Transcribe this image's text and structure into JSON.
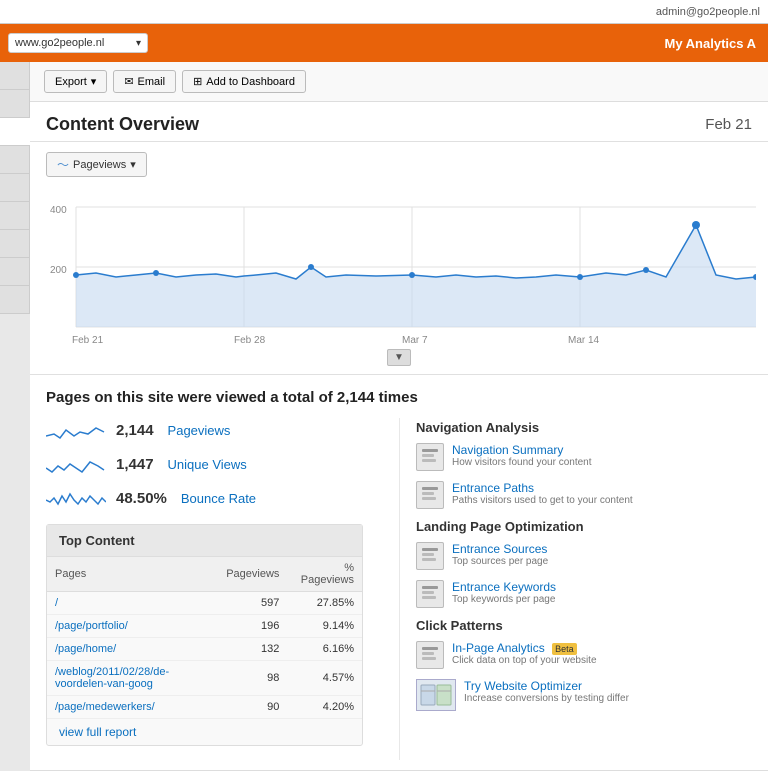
{
  "topbar": {
    "user": "admin@go2people.nl"
  },
  "navbar": {
    "url_input": "www.go2people.nl",
    "title": "My Analytics A"
  },
  "toolbar": {
    "export_label": "Export",
    "email_label": "Email",
    "dashboard_label": "Add to Dashboard"
  },
  "content_header": {
    "title": "Content Overview",
    "date": "Feb 21"
  },
  "chart": {
    "metric_btn": "Pageviews",
    "y_labels": [
      "400",
      "200"
    ],
    "x_labels": [
      "Feb 21",
      "Feb 28",
      "Mar 7",
      "Mar 14"
    ]
  },
  "stats": {
    "headline": "Pages on this site were viewed a total of 2,144 times",
    "items": [
      {
        "value": "2,144",
        "label": "Pageviews"
      },
      {
        "value": "1,447",
        "label": "Unique Views"
      },
      {
        "value": "48.50%",
        "label": "Bounce Rate"
      }
    ]
  },
  "nav_analysis": {
    "title": "Navigation Analysis",
    "items": [
      {
        "title": "Navigation Summary",
        "desc": "How visitors found your content"
      },
      {
        "title": "Entrance Paths",
        "desc": "Paths visitors used to get to your content"
      }
    ]
  },
  "landing_optimization": {
    "title": "Landing Page Optimization",
    "items": [
      {
        "title": "Entrance Sources",
        "desc": "Top sources per page"
      },
      {
        "title": "Entrance Keywords",
        "desc": "Top keywords per page"
      }
    ]
  },
  "click_patterns": {
    "title": "Click Patterns",
    "items": [
      {
        "title": "In-Page Analytics",
        "badge": "Beta",
        "desc": "Click data on top of your website"
      }
    ]
  },
  "optimizer": {
    "title": "Try Website Optimizer",
    "desc": "Increase conversions by testing differ"
  },
  "top_content": {
    "title": "Top Content",
    "columns": [
      "Pages",
      "Pageviews",
      "% Pageviews"
    ],
    "rows": [
      {
        "page": "/",
        "pageviews": "597",
        "pct": "27.85%"
      },
      {
        "page": "/page/portfolio/",
        "pageviews": "196",
        "pct": "9.14%"
      },
      {
        "page": "/page/home/",
        "pageviews": "132",
        "pct": "6.16%"
      },
      {
        "page": "/weblog/2011/02/28/de-voordelen-van-goog",
        "pageviews": "98",
        "pct": "4.57%"
      },
      {
        "page": "/page/medewerkers/",
        "pageviews": "90",
        "pct": "4.20%"
      }
    ],
    "view_full_report": "view full report"
  }
}
